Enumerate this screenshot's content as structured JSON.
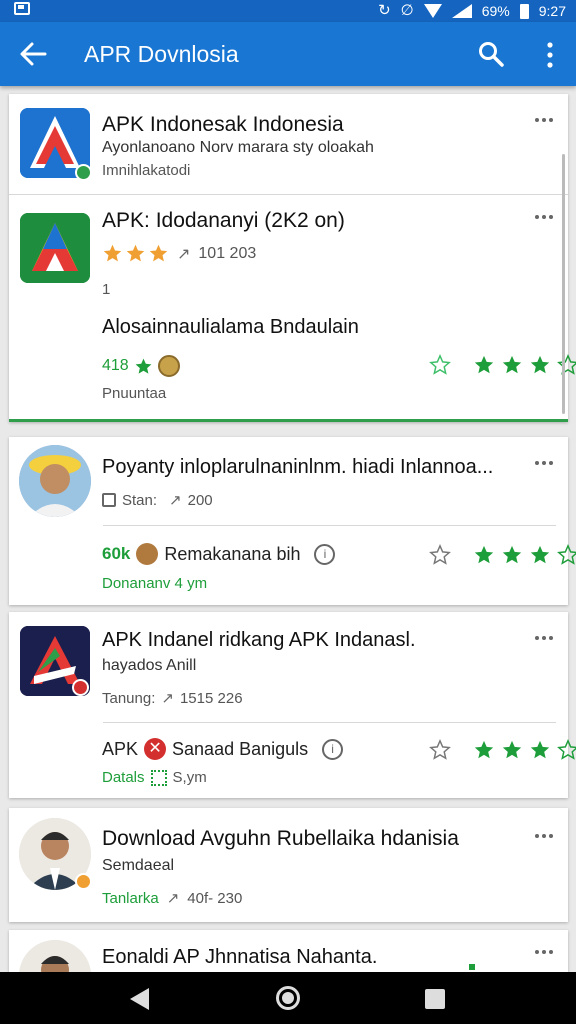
{
  "status_bar": {
    "time": "9:27",
    "battery_text": "69%",
    "sync_glyph": "↻",
    "mute_glyph": "∅"
  },
  "app_bar": {
    "title": "APR Dovnlosia"
  },
  "items": [
    {
      "title": "APK Indonesak Indonesia",
      "subtitle": "Ayonlanoano Norv marara sty oloakah",
      "meta": "Imnihlakatodi"
    },
    {
      "title": "APK: Idodananyi  (2K2 on)",
      "rating_text": "101  203",
      "line_number": "1",
      "description": "Alosainnaulialama Bndaulain",
      "count": "418",
      "footer": "Pnuuntaa"
    },
    {
      "title": "Poyanty inloplarulnaninlnm. hiadi Inlannoa...",
      "stats": "Stan:",
      "downloads": "200",
      "count": "60k",
      "label": "Remakanana bih",
      "footer": "Donananv  4 ym"
    },
    {
      "title": "APK Indanel ridkang APK Indanasl.",
      "subtitle": "hayados Anill",
      "meta_label": "Tanung:",
      "meta_value": "1515  226",
      "prefix": "APK",
      "label": "Sanaad Baniguls",
      "footer_label": "Datals",
      "footer_value": "S,ym"
    },
    {
      "title": "Download Avguhn Rubellaika  hdanisia",
      "subtitle": "Semdaeal",
      "meta_label": "Tanlarka",
      "meta_value": "40f-  230"
    },
    {
      "title": "Eonaldi AP Jhnnatisa Nahanta."
    }
  ],
  "colors": {
    "app_bar": "#1976d2",
    "status_bar": "#1565c0",
    "accent_green": "#1e9e3a",
    "star_orange": "#f0a033"
  }
}
